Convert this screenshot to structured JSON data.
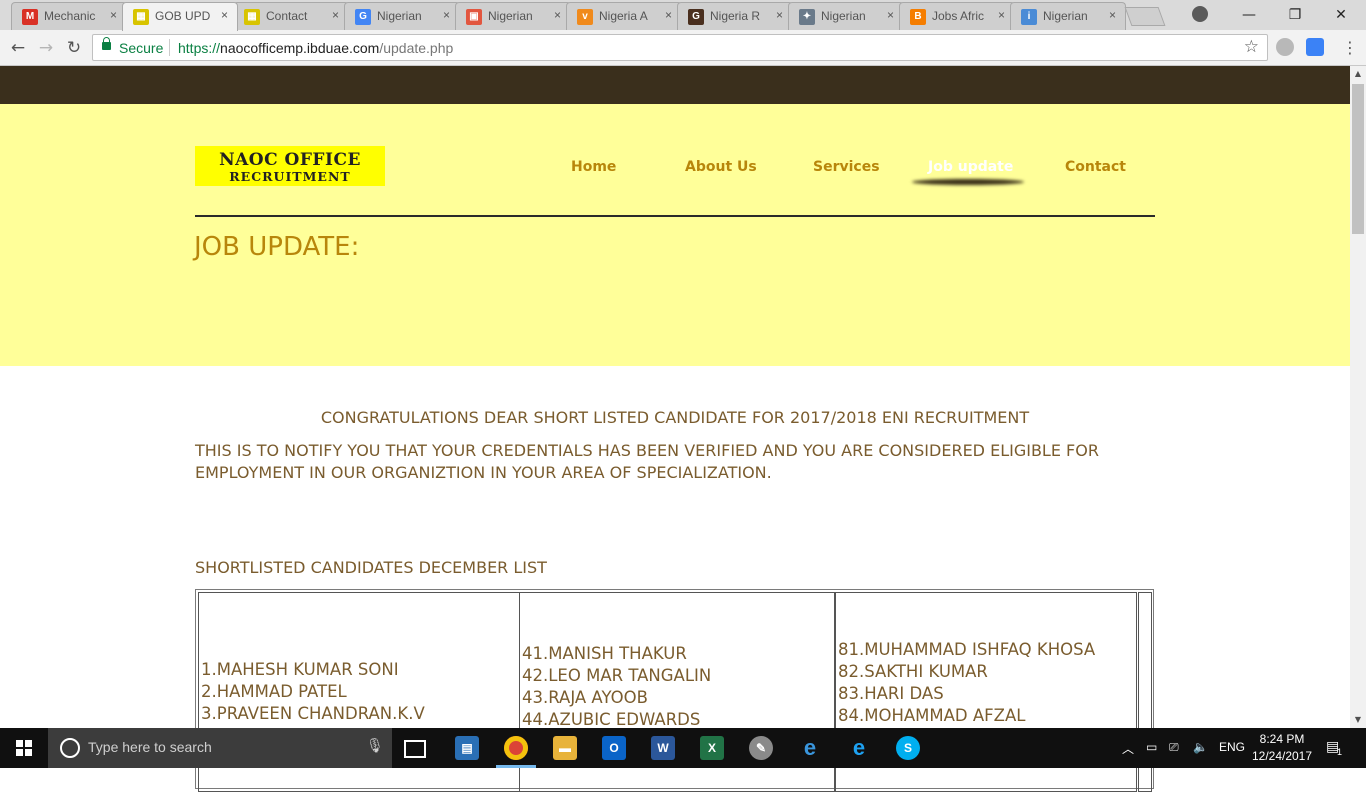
{
  "browser": {
    "tabs": [
      {
        "label": "Mechanic",
        "icon": "gmail-icon",
        "color": "#d93025",
        "glyph": "M"
      },
      {
        "label": "GOB UPD",
        "icon": "site-favicon-icon",
        "color": "#d8c400",
        "glyph": "▦"
      },
      {
        "label": "Contact",
        "icon": "site-favicon-icon",
        "color": "#d8c400",
        "glyph": "▦"
      },
      {
        "label": "Nigerian",
        "icon": "google-icon",
        "color": "#4285f4",
        "glyph": "G"
      },
      {
        "label": "Nigerian",
        "icon": "news-favicon-icon",
        "color": "#e2563f",
        "glyph": "▣"
      },
      {
        "label": "Nigeria A",
        "icon": "vanguard-icon",
        "color": "#f08a1c",
        "glyph": "v"
      },
      {
        "label": "Nigeria R",
        "icon": "guardian-icon",
        "color": "#4a2f1e",
        "glyph": "G"
      },
      {
        "label": "Nigerian",
        "icon": "site-favicon-icon",
        "color": "#6a7a8a",
        "glyph": "✦"
      },
      {
        "label": "Jobs Afric",
        "icon": "blogger-icon",
        "color": "#f57d00",
        "glyph": "B"
      },
      {
        "label": "Nigerian",
        "icon": "info-favicon-icon",
        "color": "#4a8bd6",
        "glyph": "i"
      }
    ],
    "close_glyph": "×",
    "secure_label": "Secure",
    "url_scheme": "https://",
    "url_host": "naocofficemp.ibduae.com",
    "url_path": "/update.php"
  },
  "site": {
    "logo_line1": "NAOC OFFICE",
    "logo_line2": "RECRUITMENT",
    "nav": [
      "Home",
      "About Us",
      "Services",
      "Job update",
      "Contact"
    ],
    "heading": "JOB UPDATE:",
    "congrats": "CONGRATULATIONS DEAR SHORT LISTED CANDIDATE FOR 2017/2018 ENI RECRUITMENT",
    "notify": "THIS IS TO NOTIFY YOU THAT YOUR CREDENTIALS HAS BEEN VERIFIED AND YOU ARE CONSIDERED ELIGIBLE FOR EMPLOYMENT IN OUR ORGANIZTION IN YOUR AREA OF SPECIALIZATION.",
    "list_heading": "SHORTLISTED CANDIDATES DECEMBER LIST",
    "columns": [
      [
        "1.MAHESH KUMAR SONI",
        "2.HAMMAD PATEL",
        "3.PRAVEEN CHANDRAN.K.V"
      ],
      [
        "41.MANISH THAKUR",
        "42.LEO MAR TANGALIN",
        "43.RAJA AYOOB",
        "44.AZUBIC EDWARDS"
      ],
      [
        "81.MUHAMMAD ISHFAQ KHOSA",
        "82.SAKTHI KUMAR",
        "83.HARI DAS",
        "84.MOHAMMAD AFZAL"
      ]
    ],
    "colors": {
      "top_band": "#3a2f1c",
      "header_bg": "#ffff99",
      "logo_bg": "#ffff00",
      "nav_text": "#b8860b",
      "body_text": "#7a5c2e"
    }
  },
  "taskbar": {
    "search_placeholder": "Type here to search",
    "language": "ENG",
    "time": "8:24 PM",
    "date": "12/24/2017",
    "notification_count": "1"
  }
}
